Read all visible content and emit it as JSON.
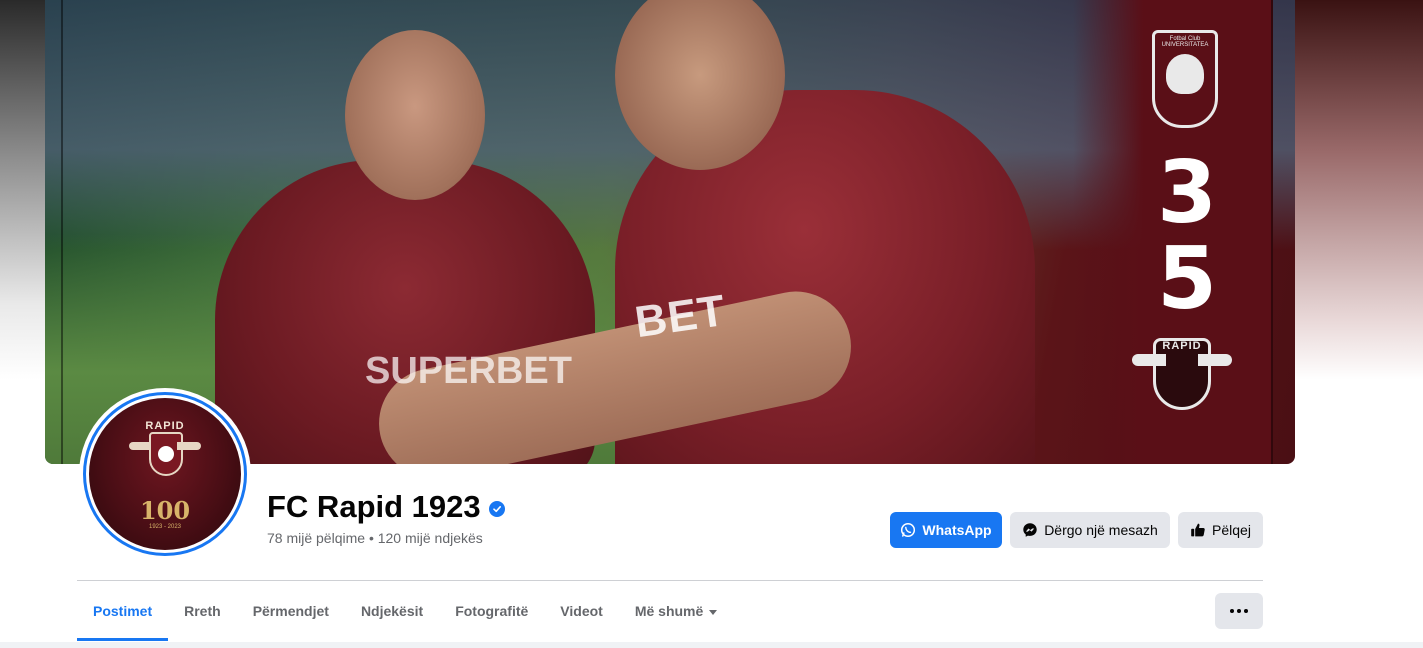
{
  "profile": {
    "name": "FC Rapid 1923",
    "stats": "78 mijë pëlqime • 120 mijë ndjekës",
    "avatar_label": "RAPID",
    "avatar_badge": "100",
    "avatar_years": "1923 - 2023"
  },
  "cover": {
    "score_home": "3",
    "score_away": "5",
    "crest_top_label": "Fotbal Club UNIVERSITATEA",
    "crest_bottom_label": "RAPID",
    "sponsor_front": "BET",
    "sponsor_back": "SUPERBET"
  },
  "actions": {
    "whatsapp": "WhatsApp",
    "message": "Dërgo një mesazh",
    "like": "Pëlqej"
  },
  "tabs": [
    {
      "label": "Postimet",
      "active": true
    },
    {
      "label": "Rreth",
      "active": false
    },
    {
      "label": "Përmendjet",
      "active": false
    },
    {
      "label": "Ndjekësit",
      "active": false
    },
    {
      "label": "Fotografitë",
      "active": false
    },
    {
      "label": "Videot",
      "active": false
    },
    {
      "label": "Më shumë",
      "active": false
    }
  ],
  "colors": {
    "accent": "#1877f2",
    "club_maroon": "#5a0f17"
  },
  "icons": {
    "verified": "verified-badge-icon",
    "whatsapp": "whatsapp-icon",
    "messenger": "messenger-icon",
    "like": "thumbs-up-icon",
    "more": "ellipsis-icon",
    "dropdown": "chevron-down-icon"
  }
}
